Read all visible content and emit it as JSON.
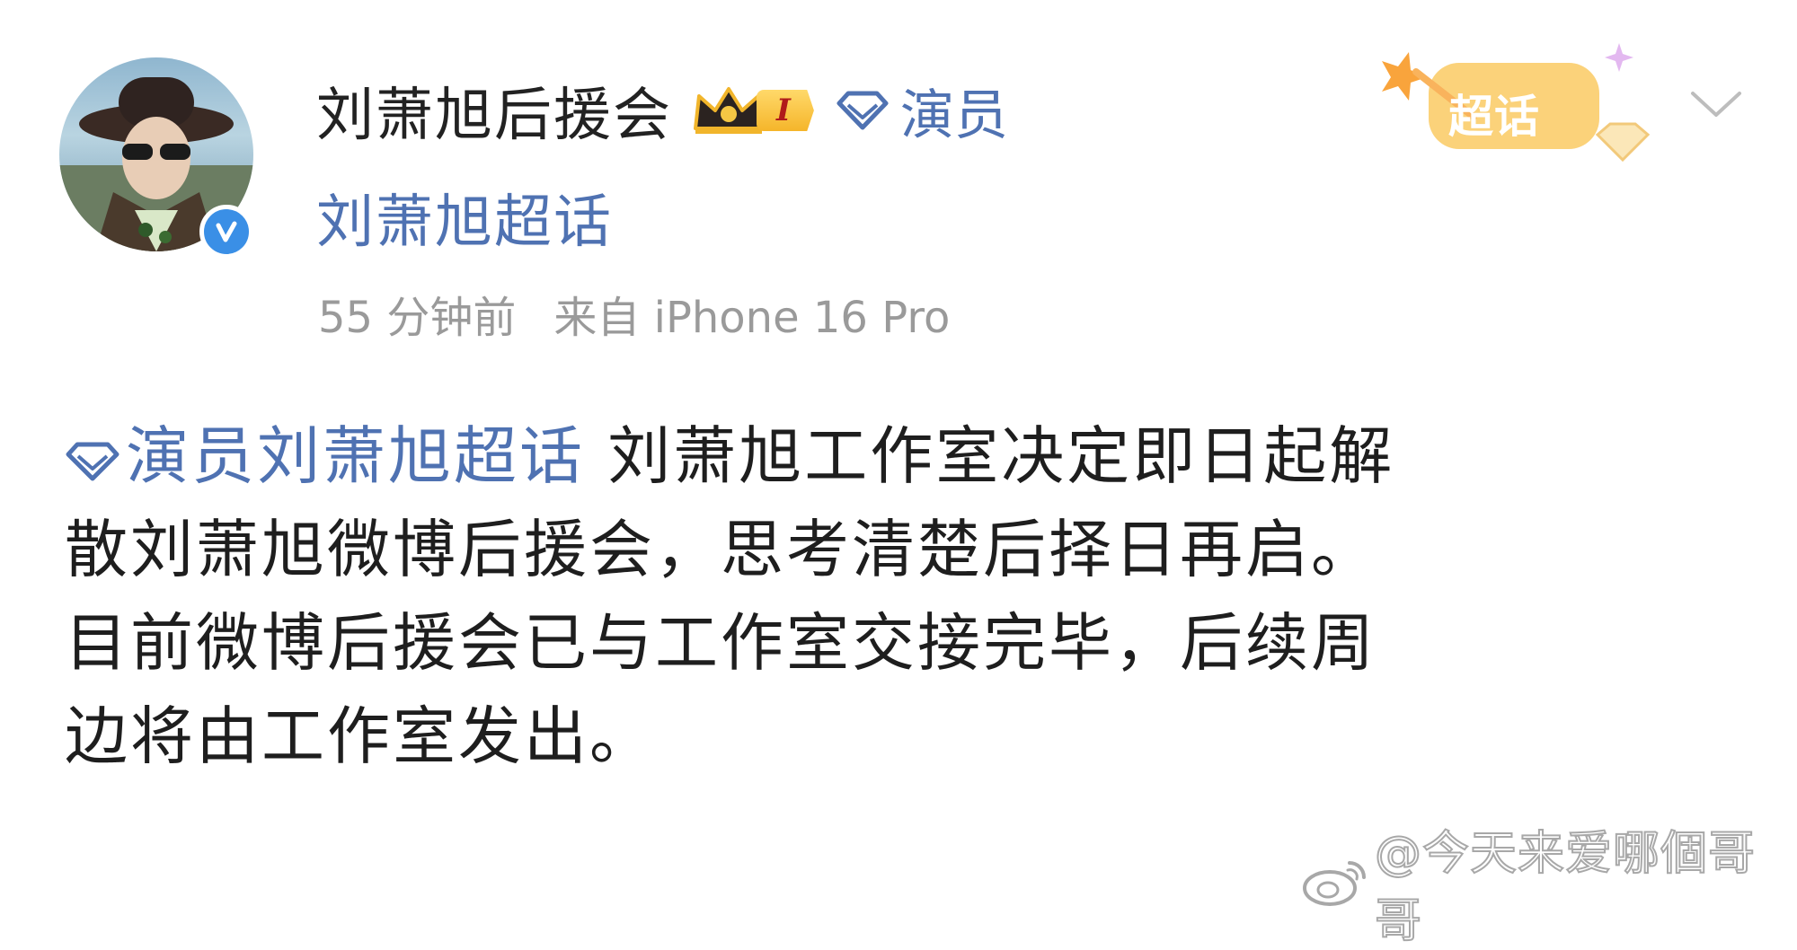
{
  "post": {
    "author": {
      "name": "刘萧旭后援会",
      "fan_level": "I",
      "role_label": "演员",
      "verified": true
    },
    "topic_link": "刘萧旭超话",
    "time": "55 分钟前",
    "source": "来自 iPhone 16 Pro",
    "supertopic_badge": "超话",
    "body": {
      "topic_tag": "演员刘萧旭超话",
      "lines": [
        " 刘萧旭工作室决定即日起解",
        "散刘萧旭微博后援会，思考清楚后择日再启。",
        "目前微博后援会已与工作室交接完毕，后续周",
        "边将由工作室发出。"
      ]
    }
  },
  "watermark": {
    "text": "@今天来爱哪個哥哥"
  },
  "colors": {
    "link_blue": "#4f72b2",
    "text": "#1e1e1e",
    "meta_gray": "#9a9a9a",
    "verified_blue": "#3a8fe6",
    "badge_gold": "#f5b52a"
  },
  "icons": {
    "verified": "verified-v-icon",
    "crown": "crown-icon",
    "diamond": "diamond-icon",
    "chevron": "chevron-down-icon",
    "weibo": "weibo-logo-icon"
  }
}
